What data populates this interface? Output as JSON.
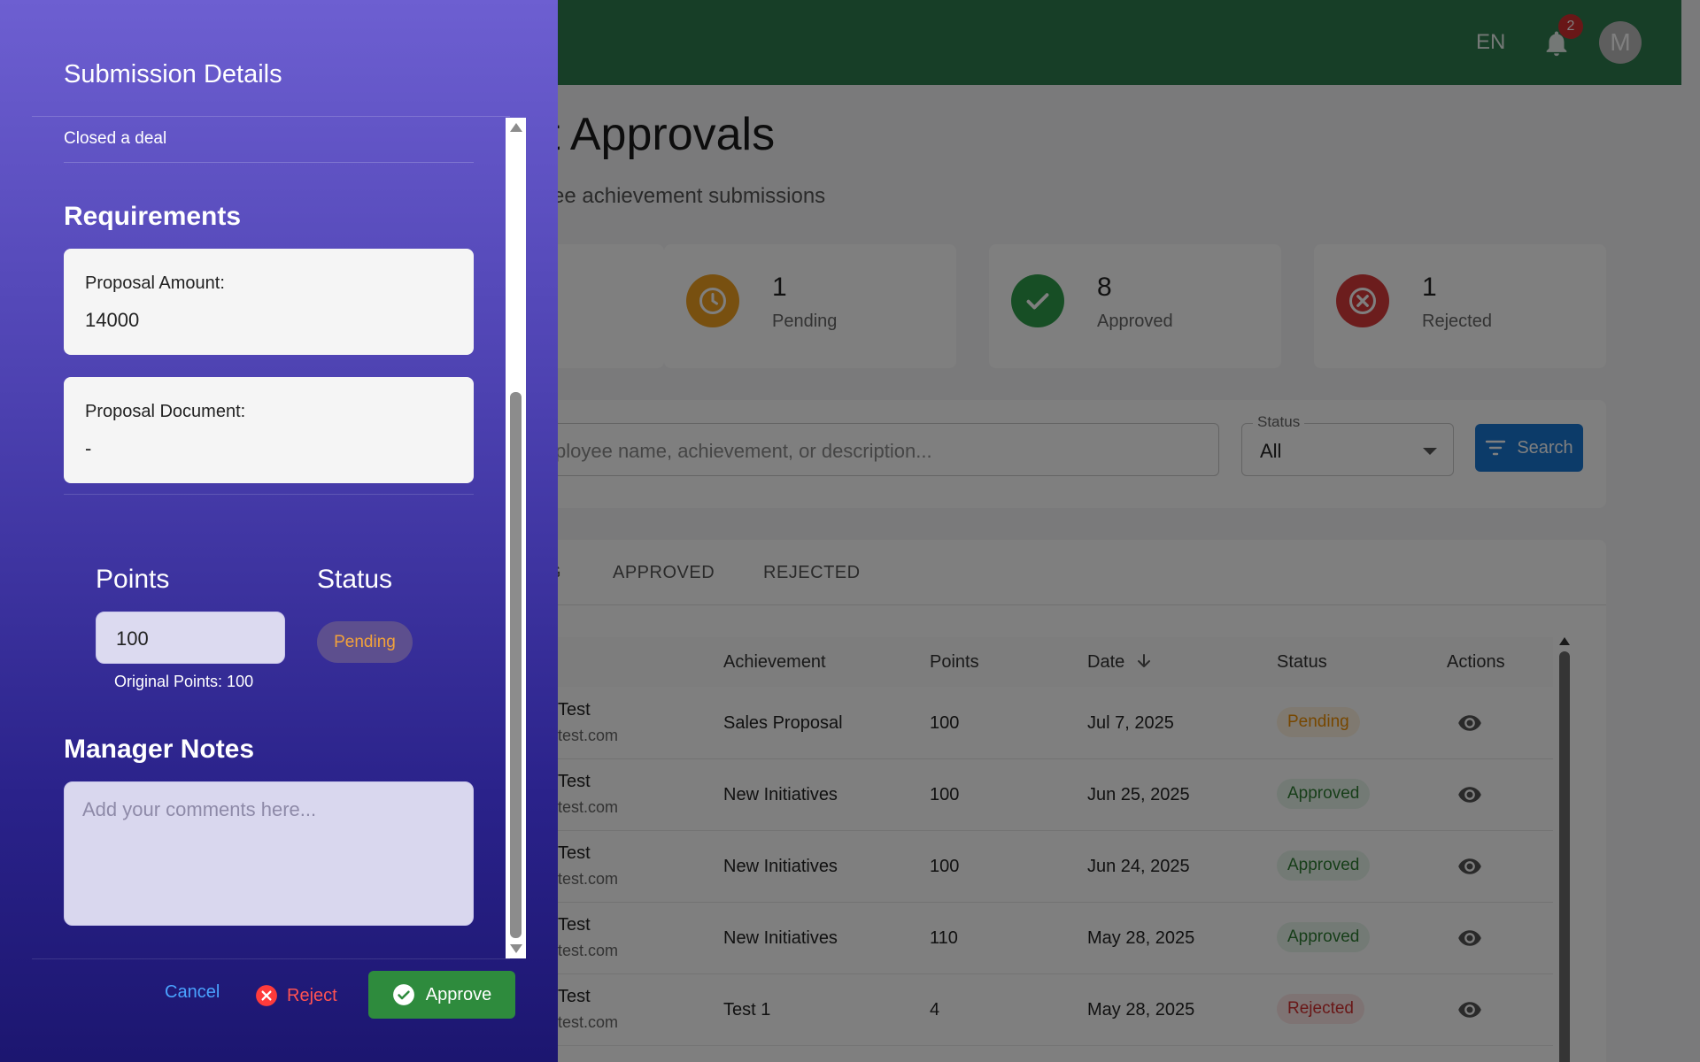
{
  "topbar": {
    "language": "EN",
    "notification_count": "2",
    "avatar_initial": "M"
  },
  "page": {
    "title": "ent Approvals",
    "subtitle": "mployee achievement submissions"
  },
  "stats": {
    "pending": {
      "value": "1",
      "label": "Pending",
      "color": "#f0a020"
    },
    "approved": {
      "value": "8",
      "label": "Approved",
      "color": "#2e9d4a"
    },
    "rejected": {
      "value": "1",
      "label": "Rejected",
      "color": "#d83a3a"
    }
  },
  "filters": {
    "search_placeholder": "ployee name, achievement, or description...",
    "status_label": "Status",
    "status_value": "All",
    "search_button": "Search"
  },
  "tabs": [
    "G",
    "APPROVED",
    "REJECTED"
  ],
  "table": {
    "headers": {
      "achievement": "Achievement",
      "points": "Points",
      "date": "Date",
      "status": "Status",
      "actions": "Actions"
    },
    "rows": [
      {
        "name": "Test",
        "email": "test.com",
        "achievement": "Sales Proposal",
        "points": "100",
        "date": "Jul 7, 2025",
        "status": "Pending"
      },
      {
        "name": "Test",
        "email": "test.com",
        "achievement": "New Initiatives",
        "points": "100",
        "date": "Jun 25, 2025",
        "status": "Approved"
      },
      {
        "name": "Test",
        "email": "test.com",
        "achievement": "New Initiatives",
        "points": "100",
        "date": "Jun 24, 2025",
        "status": "Approved"
      },
      {
        "name": "Test",
        "email": "test.com",
        "achievement": "New Initiatives",
        "points": "110",
        "date": "May 28, 2025",
        "status": "Approved"
      },
      {
        "name": "Test",
        "email": "test.com",
        "achievement": "Test 1",
        "points": "4",
        "date": "May 28, 2025",
        "status": "Rejected"
      }
    ]
  },
  "drawer": {
    "title": "Submission Details",
    "description": "Closed a deal",
    "requirements_heading": "Requirements",
    "requirements": [
      {
        "label": "Proposal Amount:",
        "value": "14000"
      },
      {
        "label": "Proposal Document:",
        "value": "-"
      }
    ],
    "points_heading": "Points",
    "points_value": "100",
    "original_points": "Original Points: 100",
    "status_heading": "Status",
    "status_value": "Pending",
    "notes_heading": "Manager Notes",
    "notes_placeholder": "Add your comments here...",
    "cancel_label": "Cancel",
    "reject_label": "Reject",
    "approve_label": "Approve"
  }
}
